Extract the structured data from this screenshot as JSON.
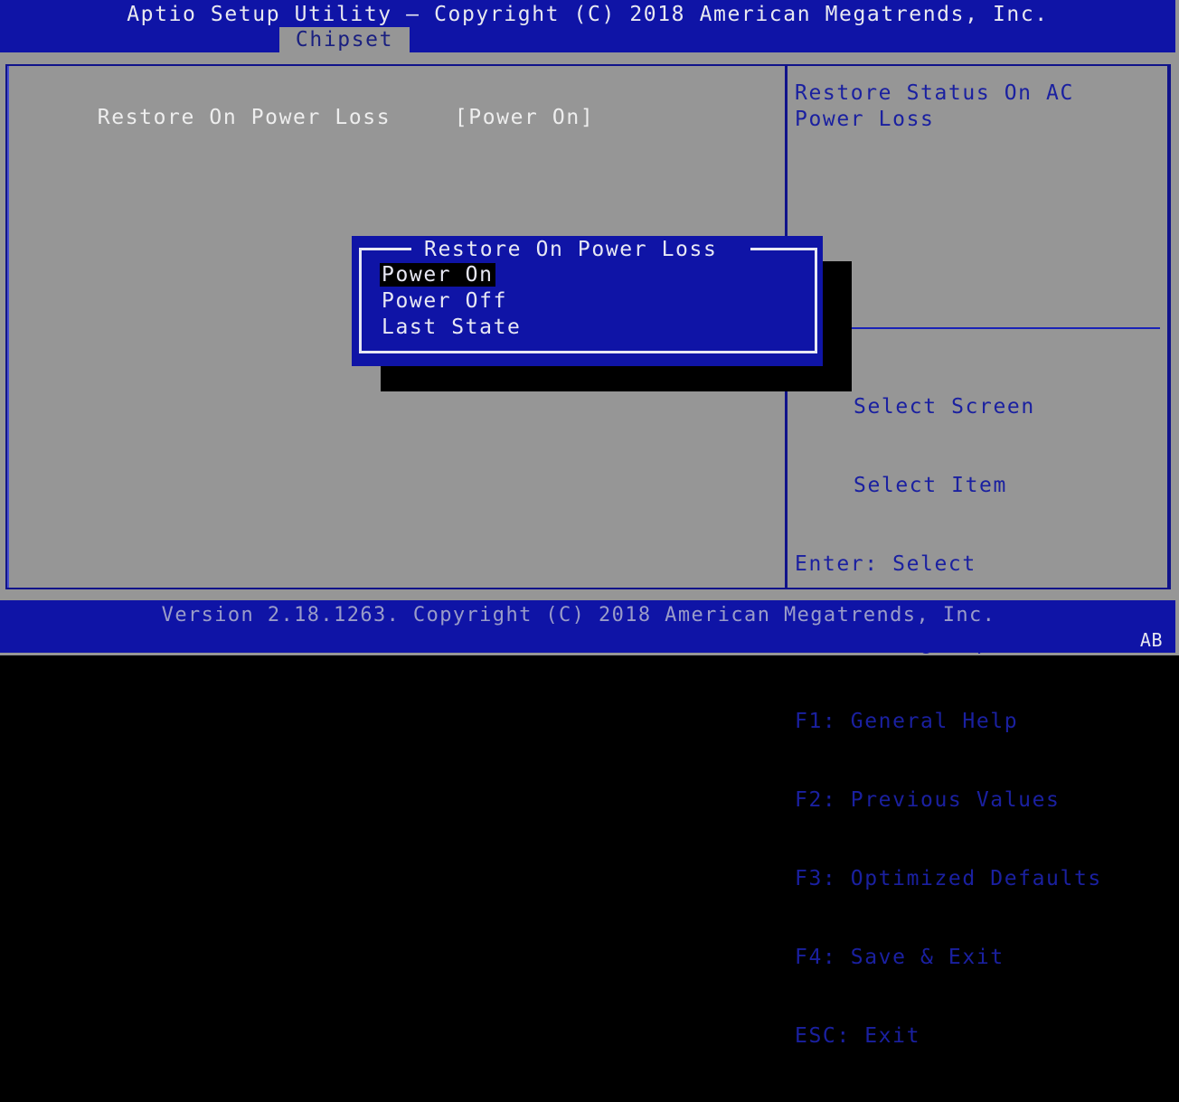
{
  "header": {
    "title": "Aptio Setup Utility – Copyright (C) 2018 American Megatrends, Inc.",
    "active_tab": "Chipset"
  },
  "main": {
    "settings": [
      {
        "label": "Restore On Power Loss",
        "value": "[Power On]"
      }
    ]
  },
  "help": {
    "description": "Restore Status On AC Power Loss",
    "keys": [
      "Select Screen",
      "Select Item",
      "Enter: Select",
      "+/-: Change Opt.",
      "F1: General Help",
      "F2: Previous Values",
      "F3: Optimized Defaults",
      "F4: Save & Exit",
      "ESC: Exit"
    ]
  },
  "popup": {
    "title": "Restore On Power Loss",
    "options": [
      {
        "label": "Power On",
        "selected": true
      },
      {
        "label": "Power Off",
        "selected": false
      },
      {
        "label": "Last State",
        "selected": false
      }
    ]
  },
  "footer": {
    "version": "Version 2.18.1263. Copyright (C) 2018 American Megatrends, Inc.",
    "badge": "AB"
  },
  "colors": {
    "header_bg": "#0f14a6",
    "panel_bg": "#969696",
    "help_text": "#1a20a0",
    "highlight_bg": "#000000"
  }
}
